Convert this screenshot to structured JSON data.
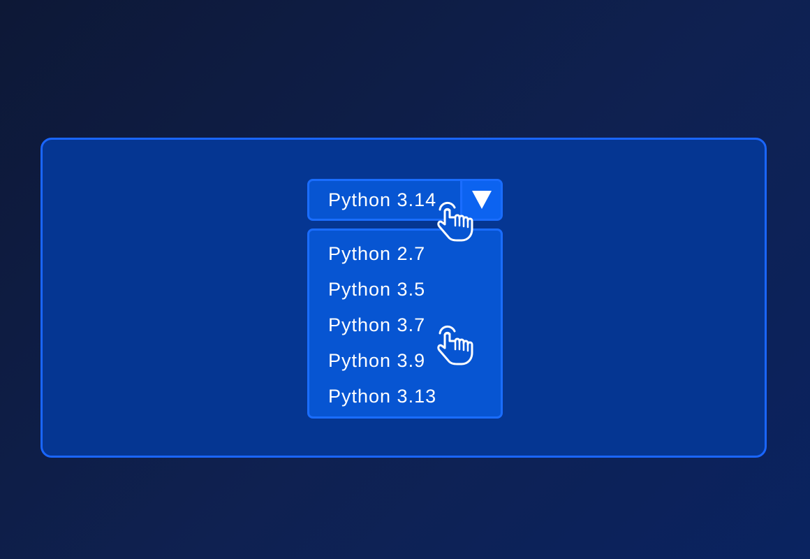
{
  "dropdown": {
    "selected_value": "Python 3.14",
    "toggle_icon": "triangle-down-icon",
    "options": [
      {
        "label": "Python 2.7"
      },
      {
        "label": "Python 3.5"
      },
      {
        "label": "Python 3.7"
      },
      {
        "label": "Python 3.9"
      },
      {
        "label": "Python 3.13"
      }
    ]
  },
  "cursor_icon": "hand-pointer-icon",
  "colors": {
    "background": "#0d1836",
    "panel_fill": "#053692",
    "accent_border": "#1a66ff",
    "control_fill": "#0755d2",
    "text": "#ffffff"
  }
}
